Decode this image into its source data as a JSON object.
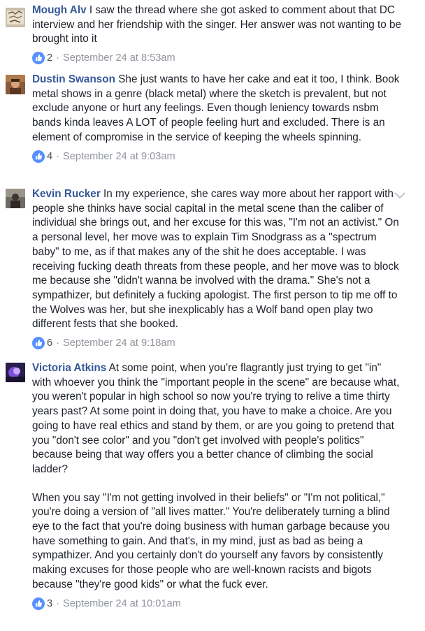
{
  "colors": {
    "author": "#365899",
    "text": "#1d2129",
    "meta": "#90949c",
    "like_blue": "#5890ff"
  },
  "comments": [
    {
      "author": "Mough Alv",
      "paragraphs": [
        "I saw the thread where she got asked to comment about that DC interview and her friendship with the singer. Her answer was not wanting to be brought into it"
      ],
      "likes": "2",
      "separator": "·",
      "timestamp": "September 24 at 8:53am",
      "avatar_icon": "avatar-image"
    },
    {
      "author": "Dustin Swanson",
      "paragraphs": [
        "She just wants to have her cake and eat it too, I think. Book metal shows in a genre (black metal) where the sketch is prevalent, but not exclude anyone or hurt any feelings. Even though leniency towards nsbm bands kinda leaves A LOT of people feeling hurt and excluded. There is an element of compromise in the service of keeping the wheels spinning."
      ],
      "likes": "4",
      "separator": "·",
      "timestamp": "September 24 at 9:03am",
      "avatar_icon": "avatar-image"
    },
    {
      "author": "Kevin Rucker",
      "paragraphs": [
        "In my experience, she cares way more about her rapport with people she thinks have social capital in the metal scene than the caliber of individual she brings out, and her excuse for this was, \"I'm not an activist.\" On a personal level, her move was to explain Tim Snodgrass as a \"spectrum baby\" to me, as if that makes any of the shit he does acceptable. I was receiving fucking death threats from these people, and her move was to block me because she \"didn't wanna be involved with the drama.\" She's not a sympathizer, but definitely a fucking apologist. The first person to tip me off to the Wolves was her, but she inexplicably has a Wolf band open play two different fests that she booked."
      ],
      "likes": "6",
      "separator": "·",
      "timestamp": "September 24 at 9:18am",
      "avatar_icon": "avatar-image",
      "menu_icon": "chevron-down-icon"
    },
    {
      "author": "Victoria Atkins",
      "paragraphs": [
        "At some point, when you're flagrantly just trying to get \"in\" with whoever you think the \"important people in the scene\" are because what, you weren't popular in high school so now you're trying to relive a time thirty years past? At some point in doing that, you have to make a choice. Are you going to have real ethics and stand by them, or are you going to pretend that you \"don't see color\" and you \"don't get involved with people's politics\" because being that way offers you a better chance of climbing the social ladder?",
        "When you say \"I'm not getting involved in their beliefs\" or \"I'm not political,\" you're doing a version of \"all lives matter.\" You're deliberately turning a blind eye to the fact that you're doing business with human garbage because you have something to gain. And that's, in my mind, just as bad as being a sympathizer. And you certainly don't do yourself any favors by consistently making excuses for those people who are well-known racists and bigots because \"they're good kids\" or what the fuck ever."
      ],
      "likes": "3",
      "separator": "·",
      "timestamp": "September 24 at 10:01am",
      "avatar_icon": "avatar-image"
    }
  ]
}
